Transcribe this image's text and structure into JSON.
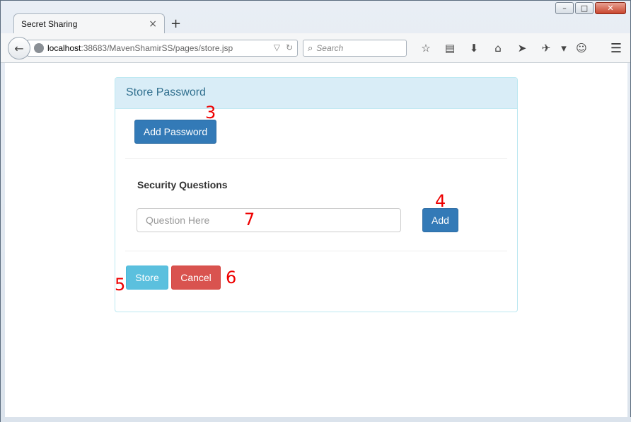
{
  "window": {
    "minimize": "–",
    "maximize": "□",
    "close": "✕"
  },
  "browser": {
    "tab_title": "Secret Sharing",
    "tab_close": "×",
    "new_tab": "+",
    "back": "←",
    "url_host": "localhost",
    "url_path": ":38683/MavenShamirSS/pages/store.jsp",
    "url_dropdown": "▽",
    "url_reload": "↻",
    "search_icon": "⌕",
    "search_placeholder": "Search",
    "toolbar": [
      {
        "name": "bookmark-star-icon",
        "glyph": "☆"
      },
      {
        "name": "reading-list-icon",
        "glyph": "▤"
      },
      {
        "name": "download-icon",
        "glyph": "⬇"
      },
      {
        "name": "home-icon",
        "glyph": "⌂"
      },
      {
        "name": "send-icon",
        "glyph": "➤"
      },
      {
        "name": "addon-icon",
        "glyph": "✈"
      },
      {
        "name": "dropdown-icon",
        "glyph": "▾"
      },
      {
        "name": "chat-icon",
        "glyph": "☺"
      }
    ],
    "menu": "☰"
  },
  "panel": {
    "heading": "Store Password",
    "add_password_label": "Add Password",
    "security_questions_label": "Security Questions",
    "question_placeholder": "Question Here",
    "add_label": "Add",
    "store_label": "Store",
    "cancel_label": "Cancel"
  },
  "annotations": {
    "a3": "3",
    "a4": "4",
    "a5": "5",
    "a6": "6",
    "a7": "7"
  }
}
